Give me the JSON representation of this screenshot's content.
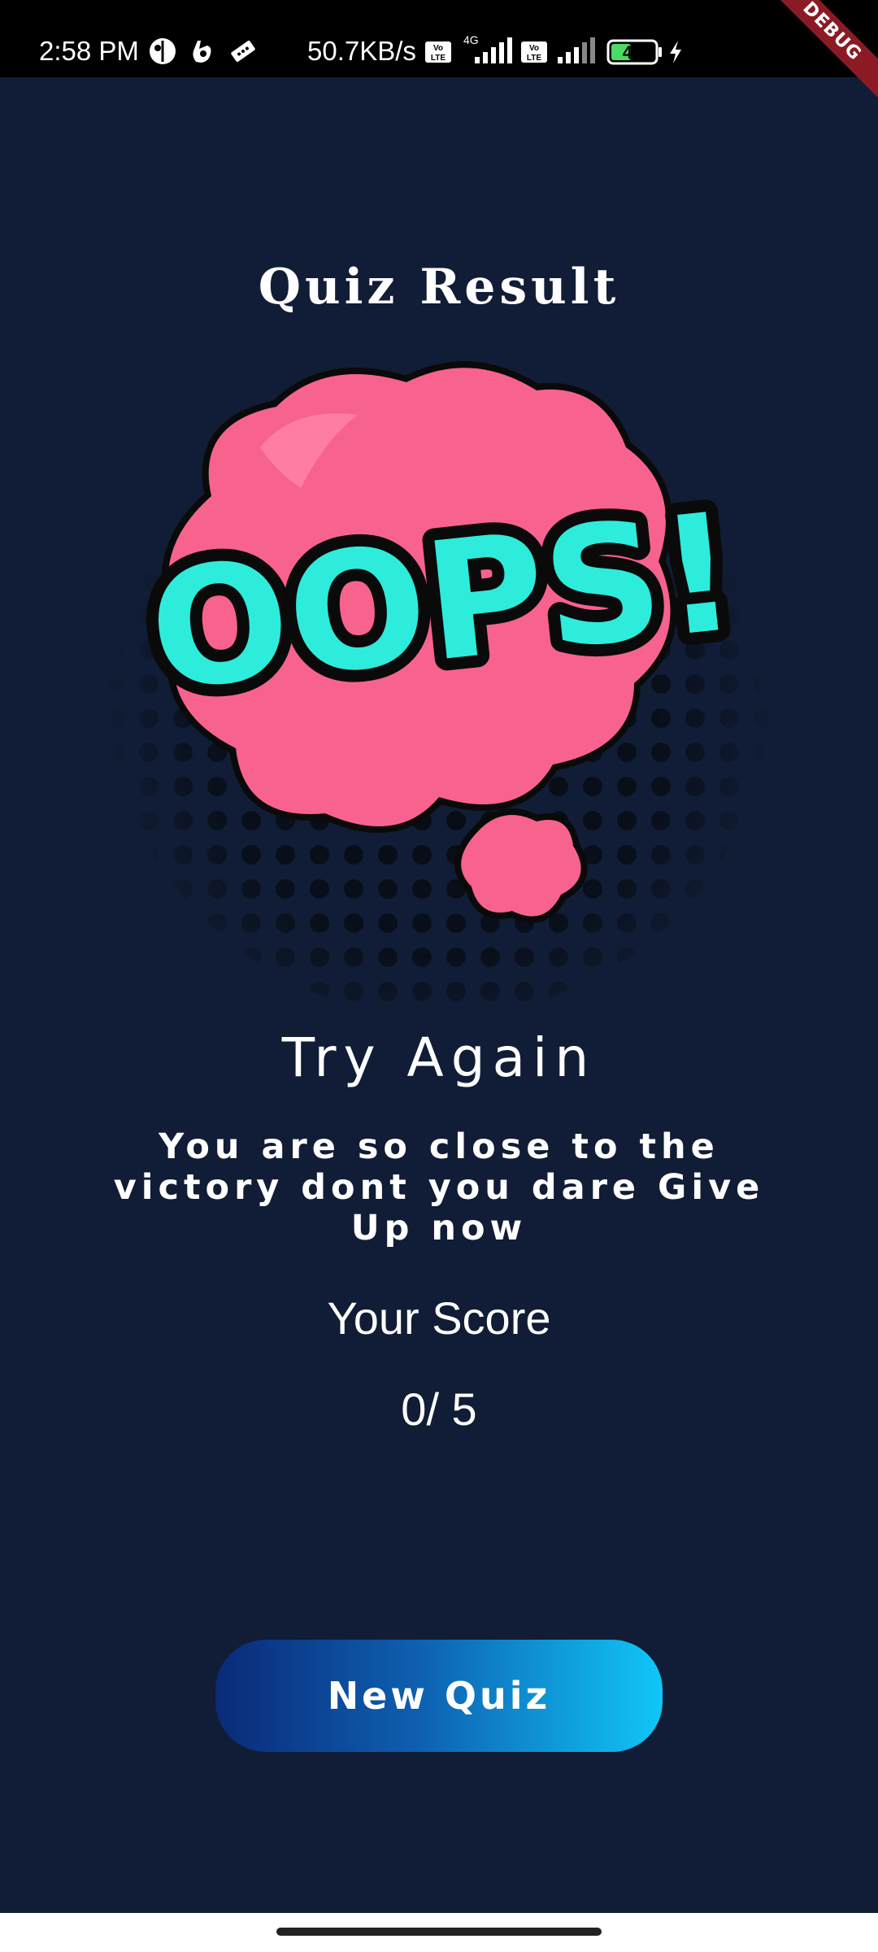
{
  "status_bar": {
    "time": "2:58 PM",
    "network_speed": "50.7KB/s",
    "network_type": "4G",
    "battery_level": "44",
    "icons": [
      "face-icon",
      "hand-icon",
      "ticket-icon",
      "volte-icon",
      "signal-icon",
      "volte-icon",
      "signal-icon",
      "battery-icon",
      "charging-icon"
    ]
  },
  "debug_banner": "DEBUG",
  "result": {
    "title": "Quiz Result",
    "illustration_icon": "oops-speech-bubble",
    "illustration_text": "OOPS!",
    "heading": "Try Again",
    "message": "You are so close to the victory dont you dare Give Up now",
    "score_label": "Your Score",
    "score_value": "0/ 5"
  },
  "actions": {
    "new_quiz_label": "New Quiz"
  },
  "colors": {
    "background": "#111D36",
    "bubble_pink": "#F8628F",
    "oops_cyan": "#2DECDC",
    "button_start": "#0A2A78",
    "button_end": "#10C6F8"
  }
}
